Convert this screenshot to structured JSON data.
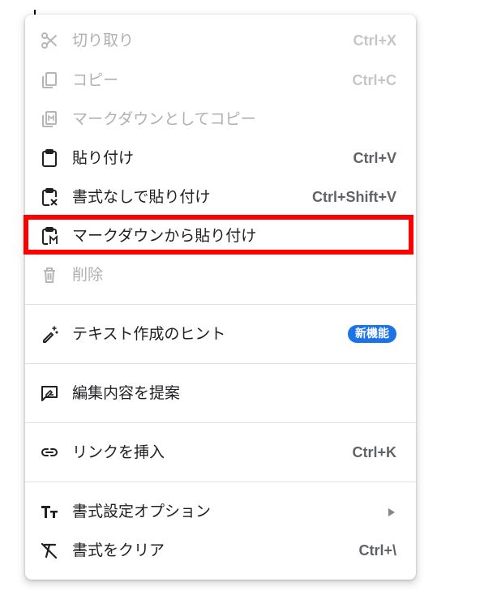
{
  "menu": {
    "items": [
      {
        "id": "cut",
        "icon": "scissors-icon",
        "label": "切り取り",
        "shortcut": "Ctrl+X",
        "disabled": true
      },
      {
        "id": "copy",
        "icon": "copy-icon",
        "label": "コピー",
        "shortcut": "Ctrl+C",
        "disabled": true
      },
      {
        "id": "copy-markdown",
        "icon": "markdown-copy-icon",
        "label": "マークダウンとしてコピー",
        "shortcut": "",
        "disabled": true
      },
      {
        "id": "paste",
        "icon": "clipboard-icon",
        "label": "貼り付け",
        "shortcut": "Ctrl+V",
        "disabled": false
      },
      {
        "id": "paste-plain",
        "icon": "clipboard-format-clear-icon",
        "label": "書式なしで貼り付け",
        "shortcut": "Ctrl+Shift+V",
        "disabled": false
      },
      {
        "id": "paste-markdown",
        "icon": "clipboard-markdown-icon",
        "label": "マークダウンから貼り付け",
        "shortcut": "",
        "disabled": false
      },
      {
        "id": "delete",
        "icon": "trash-icon",
        "label": "削除",
        "shortcut": "",
        "disabled": true
      }
    ],
    "writing_hint": {
      "icon": "magic-pen-icon",
      "label": "テキスト作成のヒント",
      "badge": "新機能"
    },
    "suggest_edits": {
      "icon": "suggest-edit-icon",
      "label": "編集内容を提案"
    },
    "insert_link": {
      "icon": "link-icon",
      "label": "リンクを挿入",
      "shortcut": "Ctrl+K"
    },
    "format_options": {
      "icon": "text-size-icon",
      "label": "書式設定オプション"
    },
    "clear_format": {
      "icon": "format-clear-icon",
      "label": "書式をクリア",
      "shortcut": "Ctrl+\\"
    }
  },
  "colors": {
    "highlight": "#ff0000",
    "badge": "#1a73e8",
    "text": "#202124",
    "disabled_text": "#aeb0b4"
  }
}
